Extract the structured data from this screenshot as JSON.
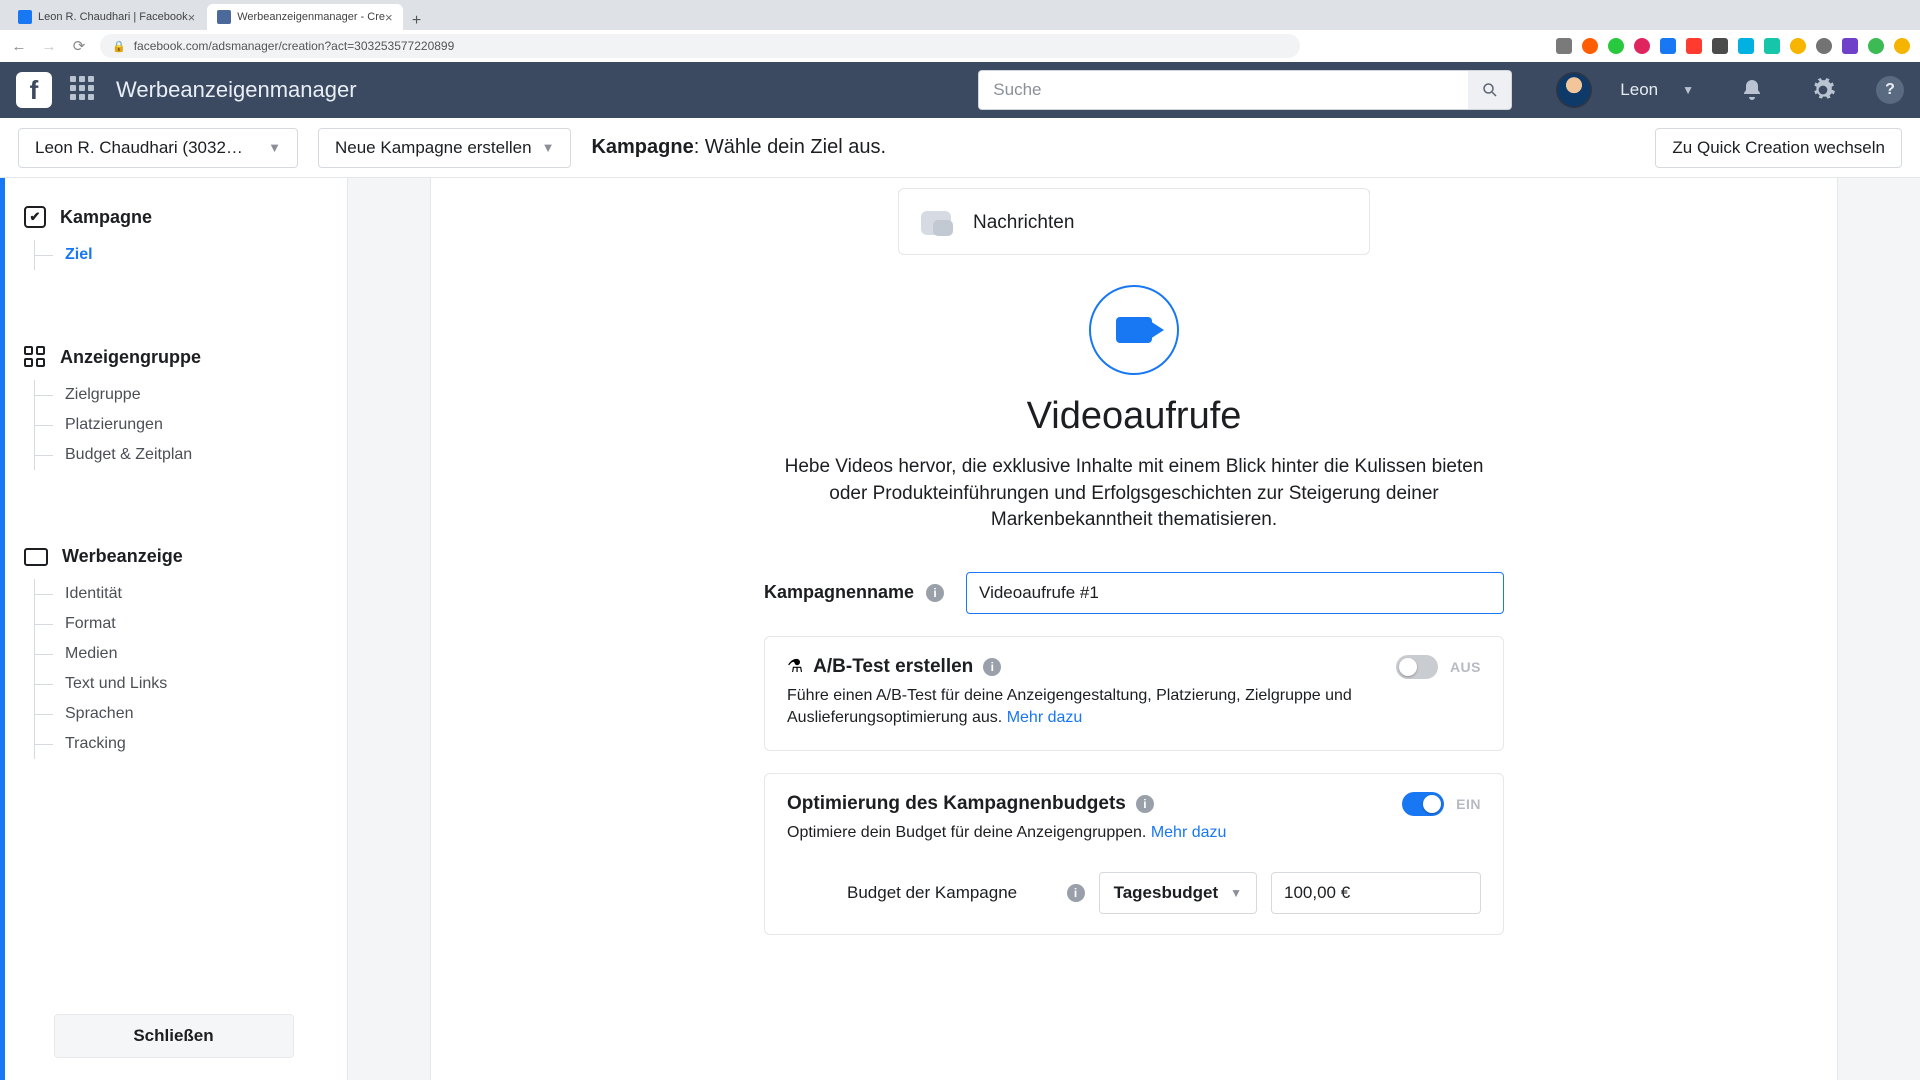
{
  "browser": {
    "tabs": [
      {
        "title": "Leon R. Chaudhari | Facebook"
      },
      {
        "title": "Werbeanzeigenmanager - Cre"
      }
    ],
    "url": "facebook.com/adsmanager/creation?act=303253577220899"
  },
  "topbar": {
    "app_title": "Werbeanzeigenmanager",
    "search_placeholder": "Suche",
    "user_name": "Leon"
  },
  "subheader": {
    "account_label": "Leon R. Chaudhari (3032…",
    "new_campaign_label": "Neue Kampagne erstellen",
    "title_strong": "Kampagne",
    "title_rest": ": Wähle dein Ziel aus.",
    "quick_label": "Zu Quick Creation wechseln"
  },
  "sidebar": {
    "campaign": {
      "head": "Kampagne",
      "items": [
        "Ziel"
      ]
    },
    "adset": {
      "head": "Anzeigengruppe",
      "items": [
        "Zielgruppe",
        "Platzierungen",
        "Budget & Zeitplan"
      ]
    },
    "ad": {
      "head": "Werbeanzeige",
      "items": [
        "Identität",
        "Format",
        "Medien",
        "Text und Links",
        "Sprachen",
        "Tracking"
      ]
    },
    "close_label": "Schließen"
  },
  "main": {
    "messages_label": "Nachrichten",
    "hero_title": "Videoaufrufe",
    "hero_desc": "Hebe Videos hervor, die exklusive Inhalte mit einem Blick hinter die Kulissen bieten oder Produkteinführungen und Erfolgsgeschichten zur Steigerung deiner Markenbekanntheit thematisieren.",
    "name_label": "Kampagnenname",
    "name_value": "Videoaufrufe #1",
    "abtest": {
      "title": "A/B-Test erstellen",
      "desc": "Führe einen A/B-Test für deine Anzeigengestaltung, Platzierung, Zielgruppe und Auslieferungsoptimierung aus. ",
      "more": "Mehr dazu",
      "state_label": "AUS"
    },
    "cbo": {
      "title": "Optimierung des Kampagnenbudgets",
      "desc": "Optimiere dein Budget für deine Anzeigengruppen. ",
      "more": "Mehr dazu",
      "state_label": "EIN"
    },
    "budget": {
      "label": "Budget der Kampagne",
      "type": "Tagesbudget",
      "amount": "100,00 €"
    }
  }
}
